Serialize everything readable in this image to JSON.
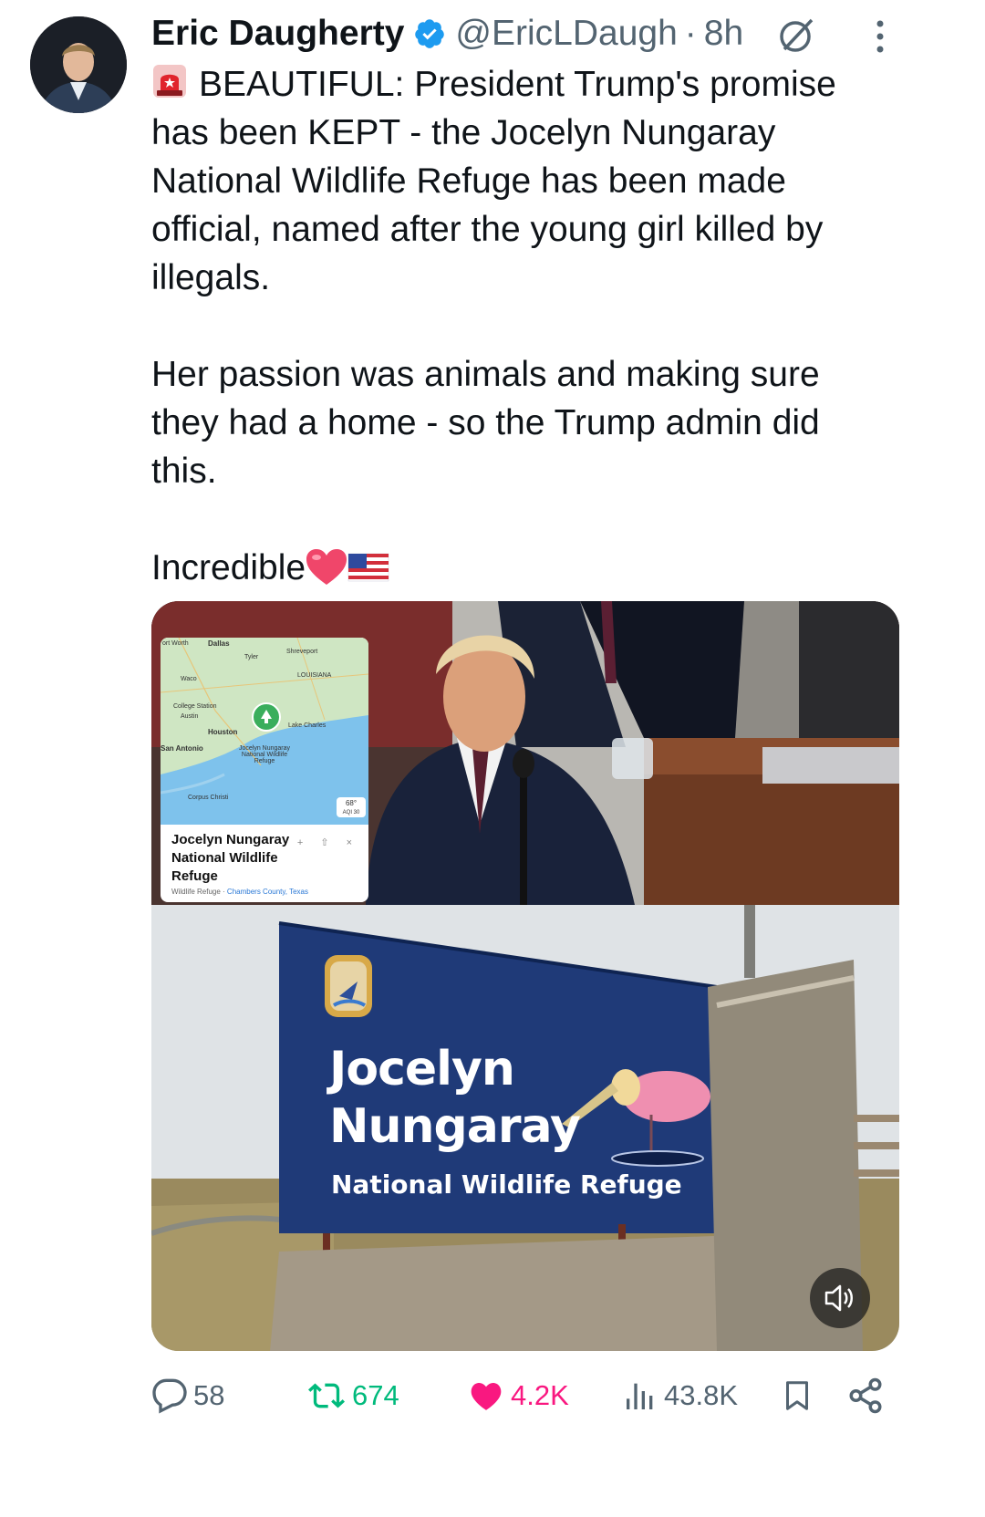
{
  "author": {
    "name": "Eric Daugherty",
    "handle": "@EricLDaugh",
    "separator": "·",
    "time": "8h",
    "verified": true
  },
  "post": {
    "paragraph1": "BEAUTIFUL: President Trump's promise has been KEPT - the Jocelyn Nungaray National Wildlife Refuge has been made official, named after the young girl killed by illegals.",
    "paragraph2": "Her passion was animals and making sure they had a home - so the Trump admin did this.",
    "paragraph3": "Incredible",
    "emojis": [
      "rotating-light",
      "red-heart",
      "us-flag"
    ]
  },
  "media": {
    "map_card": {
      "labels": {
        "fort_worth": "ort Worth",
        "dallas": "Dallas",
        "tyler": "Tyler",
        "shreveport": "Shreveport",
        "louisiana": "LOUISIANA",
        "waco": "Waco",
        "college_station": "College Station",
        "austin": "Austin",
        "houston": "Houston",
        "lake_charles": "Lake Charles",
        "san_antonio": "San Antonio",
        "pin_label": "Jocelyn Nungaray National Wildlife Refuge",
        "corpus_christi": "Corpus Christi",
        "weather": "68°",
        "aqi": "AQI 30"
      },
      "title": "Jocelyn Nungaray National Wildlife Refuge",
      "subtitle_type": "Wildlife Refuge · ",
      "subtitle_location": "Chambers County, Texas",
      "actions": "+ ⇧ ×"
    },
    "sign": {
      "line1": "Jocelyn",
      "line2": "Nungaray",
      "line3": "National Wildlife Refuge"
    }
  },
  "actions": {
    "replies": "58",
    "reposts": "674",
    "likes": "4.2K",
    "views": "43.8K"
  },
  "colors": {
    "text": "#0f1419",
    "secondary": "#536471",
    "verified": "#1d9bf0",
    "repost_active": "#00ba7c",
    "like_active": "#f91880",
    "sign_blue": "#1f3a78"
  }
}
